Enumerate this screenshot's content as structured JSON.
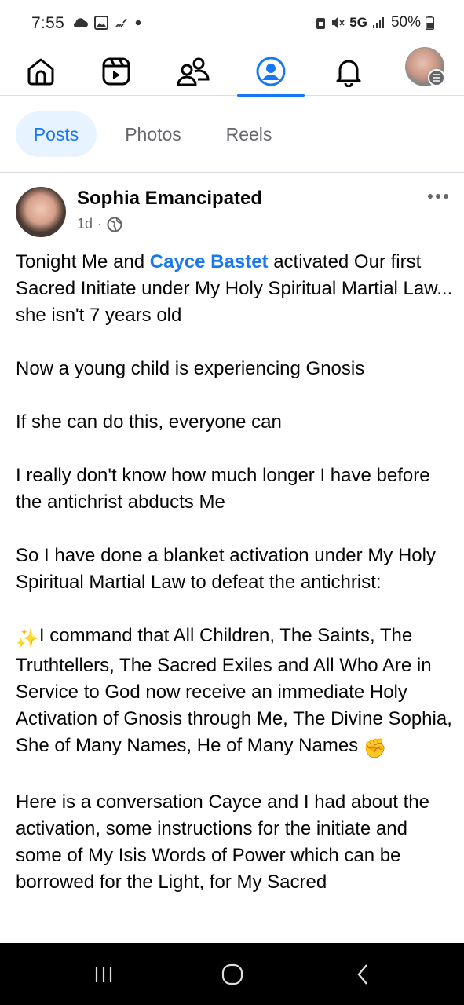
{
  "status_bar": {
    "time": "7:55",
    "network": "5G",
    "battery": "50%",
    "icons": [
      "cloud-icon",
      "gallery-icon",
      "missed-call-icon",
      "dot-icon",
      "lock-icon",
      "mute-icon",
      "signal-icon",
      "battery-icon"
    ]
  },
  "nav": {
    "items": [
      {
        "name": "home-icon",
        "active": false
      },
      {
        "name": "video-icon",
        "active": false
      },
      {
        "name": "friends-icon",
        "active": false
      },
      {
        "name": "profile-icon",
        "active": true
      },
      {
        "name": "notifications-icon",
        "active": false
      },
      {
        "name": "menu-avatar",
        "active": false
      }
    ],
    "accent": "#1877f2"
  },
  "tabs": [
    {
      "label": "Posts",
      "active": true
    },
    {
      "label": "Photos",
      "active": false
    },
    {
      "label": "Reels",
      "active": false
    }
  ],
  "post": {
    "author": "Sophia Emancipated",
    "time": "1d",
    "separator": "·",
    "privacy_icon": "globe-icon",
    "body": {
      "p1_before": "Tonight Me and ",
      "p1_mention": "Cayce Bastet",
      "p1_after": " activated Our first Sacred Initiate under My Holy Spiritual Martial Law... she isn't 7 years old",
      "p2": "Now a young child is experiencing Gnosis",
      "p3": "If she can do this, everyone can",
      "p4": "I really don't know how much longer I have before the antichrist abducts Me",
      "p5": "So I have done a blanket activation under My Holy Spiritual Martial Law to defeat the antichrist:",
      "p6_emoji": "✨",
      "p6": "I command that All Children, The Saints, The Truthtellers, The Sacred Exiles and All Who Are in Service to God now receive an immediate Holy Activation of Gnosis through Me, The Divine Sophia, She of Many Names, He of Many Names",
      "p6_end_emoji": "✊",
      "p7": "Here is a conversation Cayce and I had about the activation, some instructions for the initiate and some of My Isis Words of Power which can be borrowed for the Light, for My Sacred"
    }
  },
  "system_nav": {
    "recents": "|||",
    "home": "○",
    "back": "‹"
  }
}
